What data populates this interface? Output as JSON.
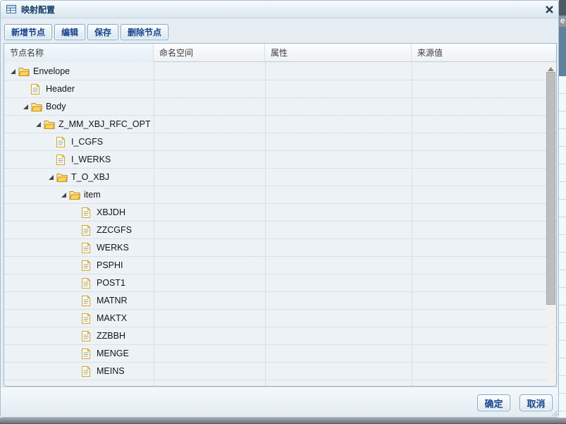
{
  "window": {
    "title": "映射配置",
    "close_glyph": "✕"
  },
  "toolbar": {
    "buttons": [
      {
        "label": "新增节点"
      },
      {
        "label": "编辑"
      },
      {
        "label": "保存"
      },
      {
        "label": "删除节点"
      }
    ]
  },
  "grid": {
    "columns": [
      {
        "label": "节点名称"
      },
      {
        "label": "命名空间"
      },
      {
        "label": "属性"
      },
      {
        "label": "来源值"
      }
    ],
    "tree": [
      {
        "label": "Envelope",
        "level": 0,
        "type": "folder",
        "expanded": true
      },
      {
        "label": "Header",
        "level": 1,
        "type": "leaf"
      },
      {
        "label": "Body",
        "level": 1,
        "type": "folder",
        "expanded": true
      },
      {
        "label": "Z_MM_XBJ_RFC_OPT",
        "level": 2,
        "type": "folder",
        "expanded": true
      },
      {
        "label": "I_CGFS",
        "level": 3,
        "type": "leaf"
      },
      {
        "label": "I_WERKS",
        "level": 3,
        "type": "leaf"
      },
      {
        "label": "T_O_XBJ",
        "level": 3,
        "type": "folder",
        "expanded": true
      },
      {
        "label": "item",
        "level": 4,
        "type": "folder",
        "expanded": true
      },
      {
        "label": "XBJDH",
        "level": 5,
        "type": "leaf"
      },
      {
        "label": "ZZCGFS",
        "level": 5,
        "type": "leaf"
      },
      {
        "label": "WERKS",
        "level": 5,
        "type": "leaf"
      },
      {
        "label": "PSPHI",
        "level": 5,
        "type": "leaf"
      },
      {
        "label": "POST1",
        "level": 5,
        "type": "leaf"
      },
      {
        "label": "MATNR",
        "level": 5,
        "type": "leaf"
      },
      {
        "label": "MAKTX",
        "level": 5,
        "type": "leaf"
      },
      {
        "label": "ZZBBH",
        "level": 5,
        "type": "leaf"
      },
      {
        "label": "MENGE",
        "level": 5,
        "type": "leaf"
      },
      {
        "label": "MEINS",
        "level": 5,
        "type": "leaf"
      }
    ]
  },
  "footer": {
    "buttons": [
      {
        "label": "确定"
      },
      {
        "label": "取消"
      }
    ]
  },
  "background": {
    "fragment_text": "e"
  },
  "colors": {
    "accent_text": "#15428b",
    "button_border": "#84a9c5",
    "dialog_bg": "#e6edf3",
    "panel_border": "#9cb8ca",
    "folder_icon": "#ffd24e",
    "leaf_icon": "#fffbe8",
    "scroll_thumb": "#bdbdbd",
    "backdrop_blue": "#60819d",
    "backdrop_dark": "#4d5862"
  }
}
